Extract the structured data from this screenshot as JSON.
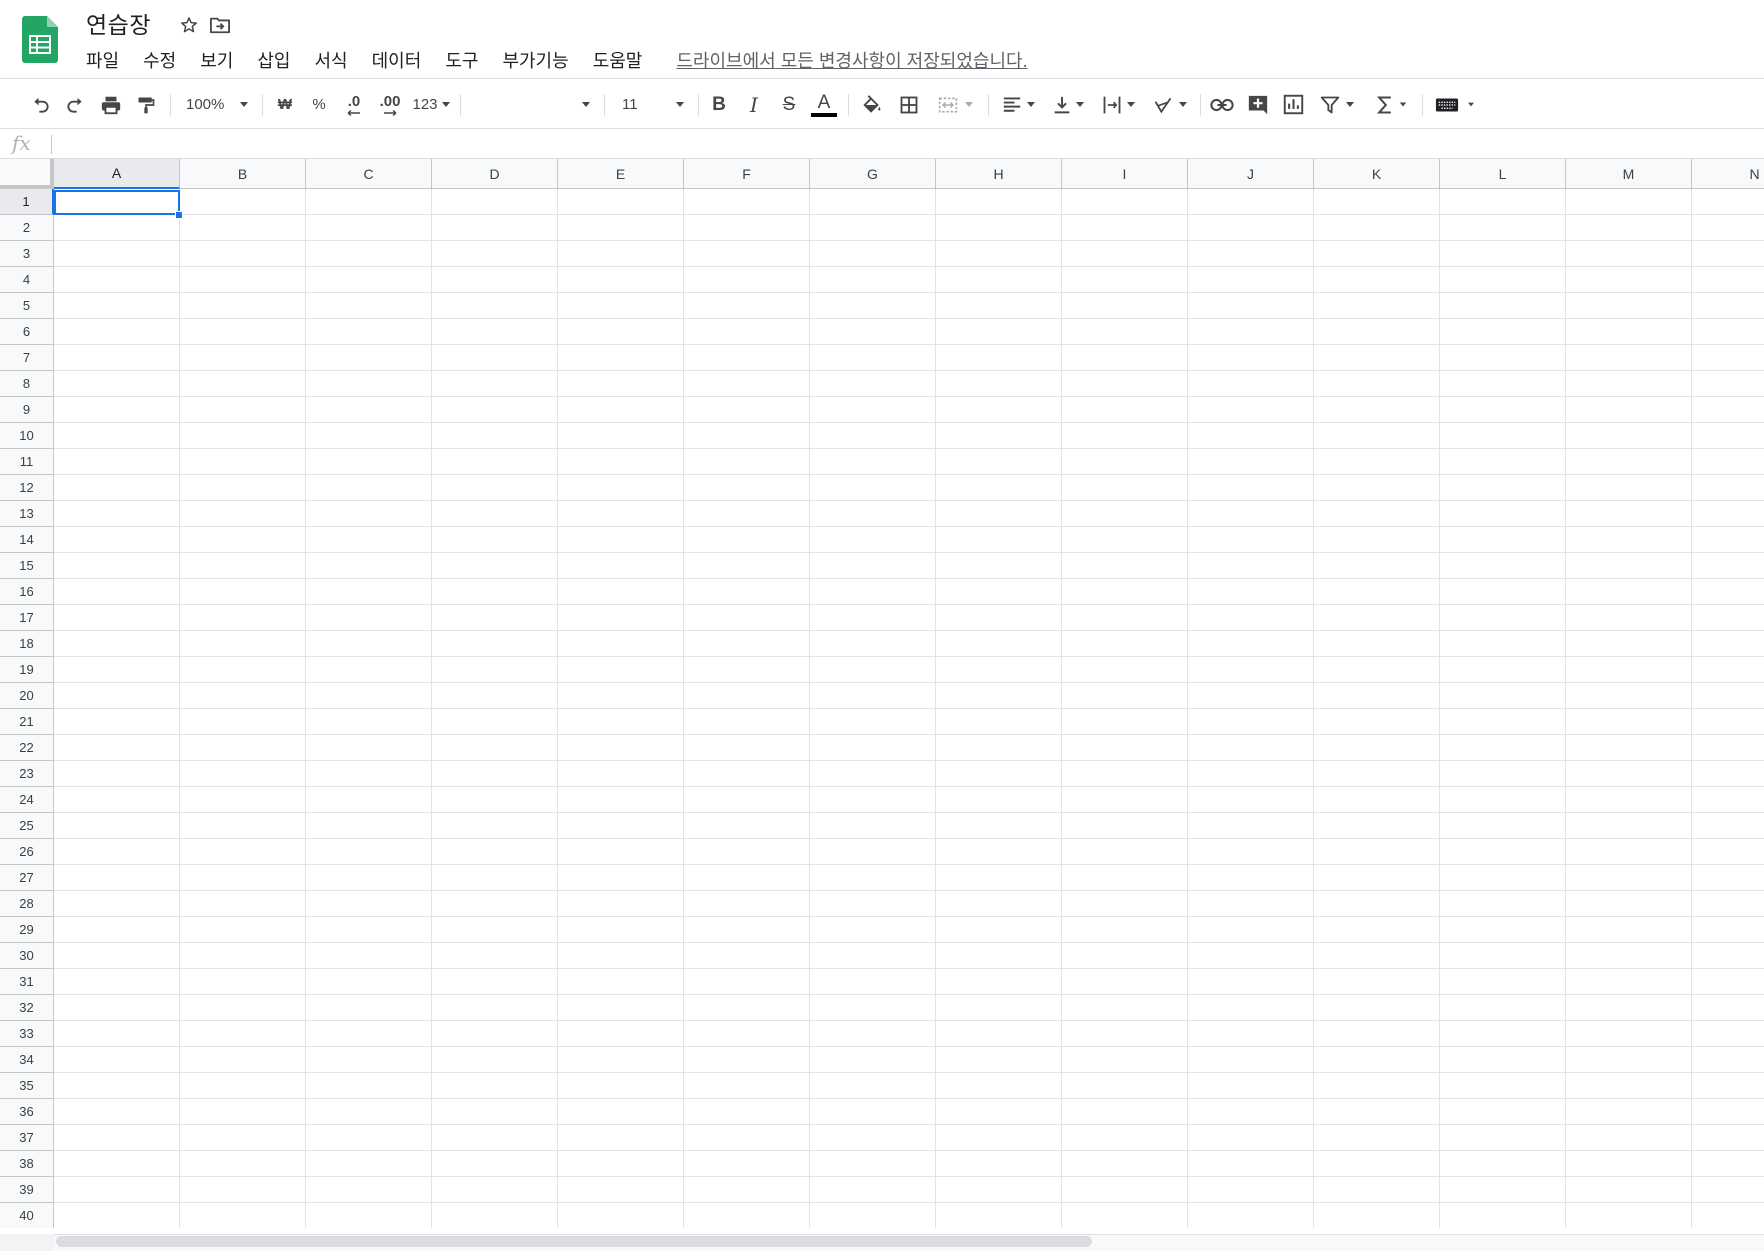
{
  "header": {
    "doc_title": "연습장",
    "save_status": "드라이브에서 모든 변경사항이 저장되었습니다.",
    "menus": [
      {
        "name": "menu-file",
        "label": "파일"
      },
      {
        "name": "menu-edit",
        "label": "수정"
      },
      {
        "name": "menu-view",
        "label": "보기"
      },
      {
        "name": "menu-insert",
        "label": "삽입"
      },
      {
        "name": "menu-format",
        "label": "서식"
      },
      {
        "name": "menu-data",
        "label": "데이터"
      },
      {
        "name": "menu-tools",
        "label": "도구"
      },
      {
        "name": "menu-addons",
        "label": "부가기능"
      },
      {
        "name": "menu-help",
        "label": "도움말"
      }
    ]
  },
  "toolbar": {
    "zoom": "100%",
    "currency_symbol": "₩",
    "percent_symbol": "%",
    "decimal_decrease": ".0",
    "decimal_increase": ".00",
    "more_formats": "123",
    "font_family": "",
    "font_size": "11",
    "bold": "B",
    "italic": "I",
    "strikethrough": "S",
    "text_color_letter": "A",
    "text_color": "#000000"
  },
  "formula_bar": {
    "fx_label": "fx",
    "value": ""
  },
  "grid": {
    "columns": [
      "A",
      "B",
      "C",
      "D",
      "E",
      "F",
      "G",
      "H",
      "I",
      "J",
      "K",
      "L",
      "M",
      "N"
    ],
    "rows": [
      "1",
      "2",
      "3",
      "4",
      "5",
      "6",
      "7",
      "8",
      "9",
      "10",
      "11",
      "12",
      "13",
      "14",
      "15",
      "16",
      "17",
      "18",
      "19",
      "20",
      "21",
      "22",
      "23",
      "24",
      "25",
      "26",
      "27",
      "28",
      "29",
      "30",
      "31",
      "32",
      "33",
      "34",
      "35",
      "36",
      "37",
      "38",
      "39",
      "40"
    ],
    "selected_column": "A",
    "selected_row": "1"
  },
  "colors": {
    "accent": "#1a73e8",
    "logo_green": "#23a566"
  }
}
